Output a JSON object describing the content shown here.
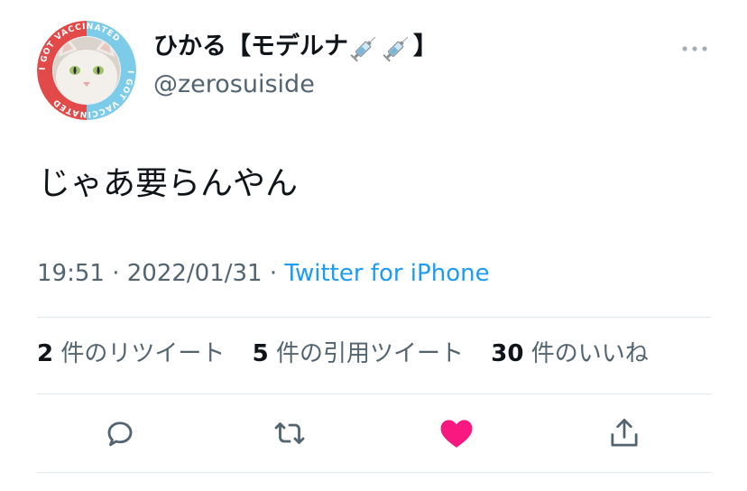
{
  "user": {
    "display_name": "ひかる【モデルナ",
    "display_name_end": "】",
    "handle": "@zerosuiside",
    "avatar_badge_top": "I GOT VACCINATED",
    "avatar_badge_bottom": "I GOT VACCINATED"
  },
  "tweet": {
    "text": "じゃあ要らんやん",
    "time": "19:51",
    "separator": "·",
    "date": "2022/01/31",
    "source": "Twitter for iPhone"
  },
  "stats": {
    "retweets_count": "2",
    "retweets_label": "件のリツイート",
    "quotes_count": "5",
    "quotes_label": "件の引用ツイート",
    "likes_count": "30",
    "likes_label": "件のいいね"
  },
  "colors": {
    "accent": "#1d9bf0",
    "like": "#f91880",
    "secondary_text": "#536471",
    "divider": "#e1e6ea"
  },
  "icons": {
    "more": "more-horizontal-icon",
    "reply": "reply-icon",
    "retweet": "retweet-icon",
    "like": "heart-filled-icon",
    "share": "share-icon",
    "syringe": "syringe-icon"
  }
}
